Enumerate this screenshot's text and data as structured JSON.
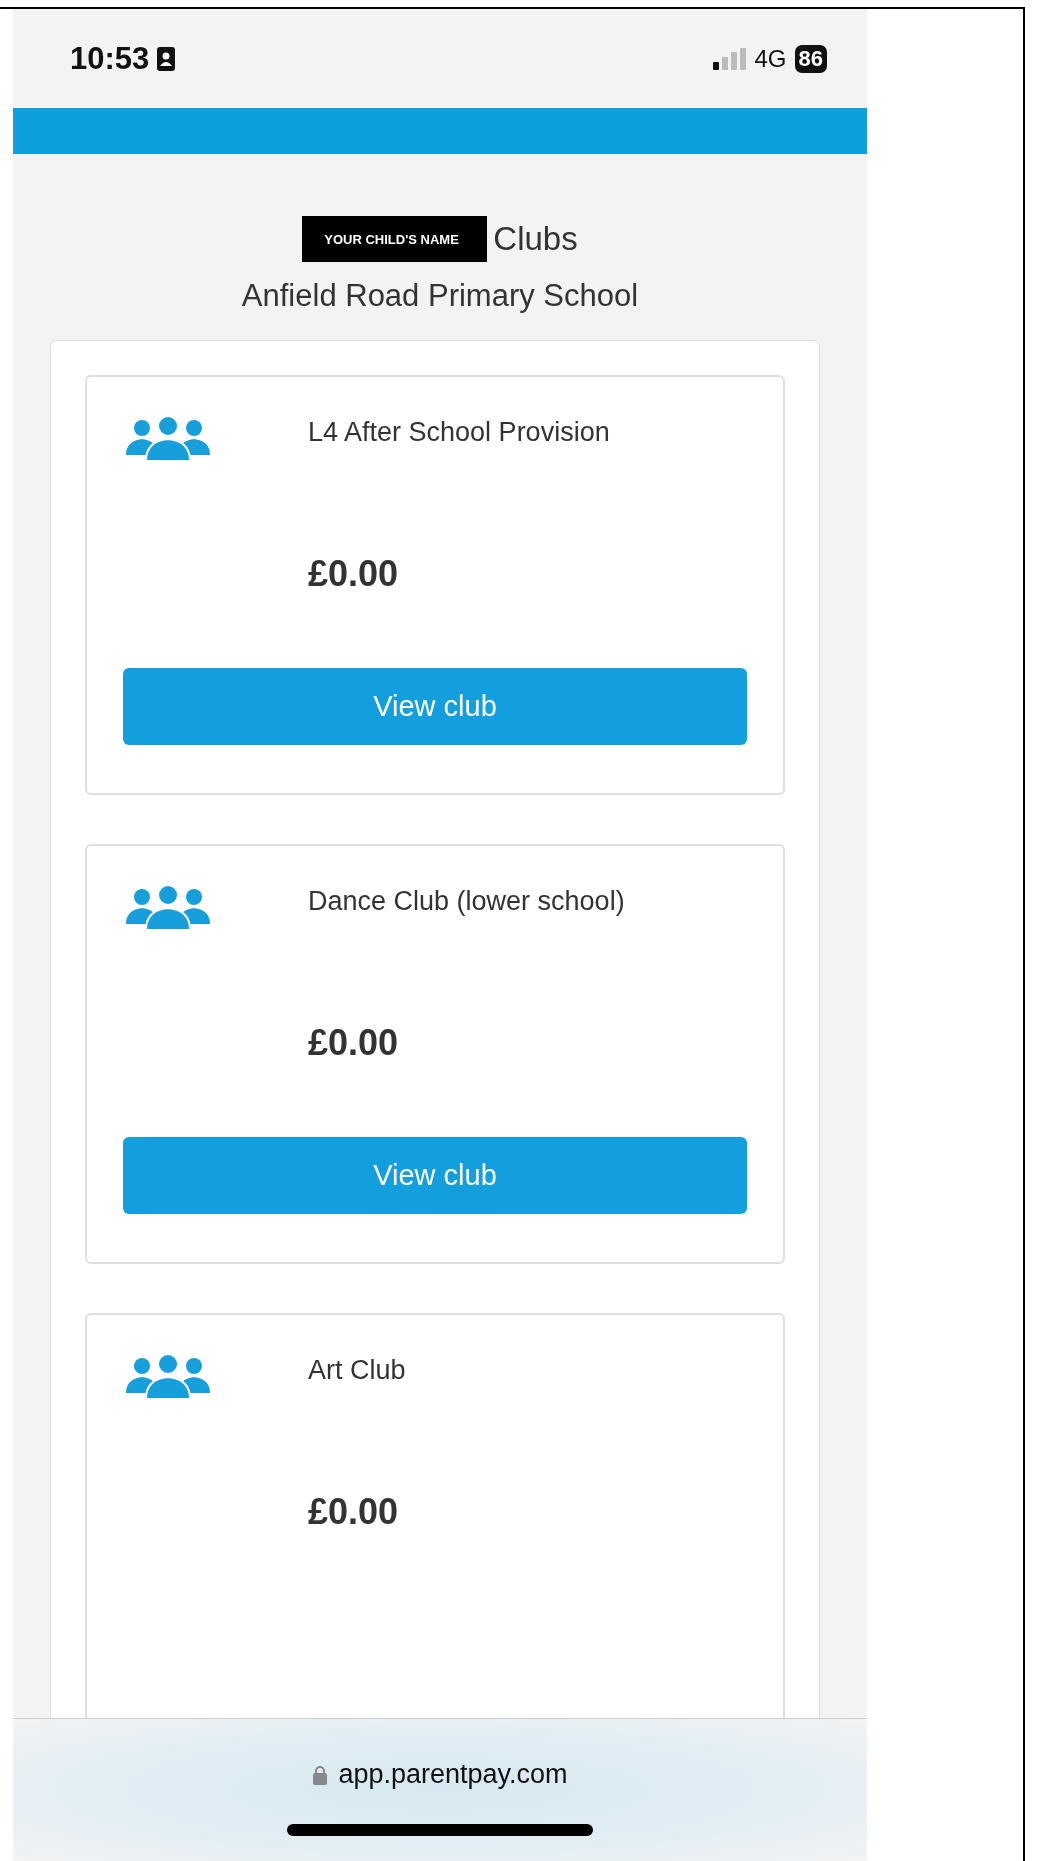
{
  "status_bar": {
    "time": "10:53",
    "network": "4G",
    "battery": "86"
  },
  "header": {
    "redaction_label": "YOUR CHILD'S NAME",
    "title": "Clubs",
    "subtitle": "Anfield Road Primary School"
  },
  "clubs": [
    {
      "name": "L4 After School Provision",
      "price": "£0.00",
      "button": "View club"
    },
    {
      "name": "Dance Club (lower school)",
      "price": "£0.00",
      "button": "View club"
    },
    {
      "name": "Art Club",
      "price": "£0.00"
    }
  ],
  "address_bar": {
    "url": "app.parentpay.com"
  }
}
